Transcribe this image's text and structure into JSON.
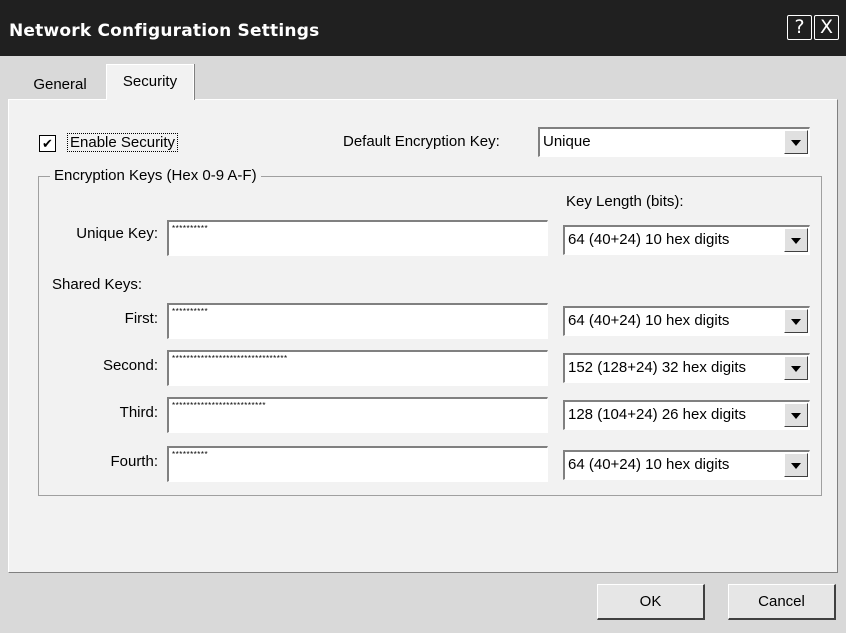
{
  "window": {
    "title": "Network Configuration Settings",
    "help_glyph": "?",
    "close_glyph": "X"
  },
  "tabs": [
    {
      "label": "General",
      "selected": false
    },
    {
      "label": "Security",
      "selected": true
    }
  ],
  "security": {
    "enable_label": "Enable Security",
    "enable_checked": true,
    "check_glyph": "✔",
    "default_key_label": "Default Encryption Key:",
    "default_key_value": "Unique"
  },
  "keys_group": {
    "legend": "Encryption Keys (Hex 0-9 A-F)",
    "key_length_label": "Key Length (bits):",
    "shared_keys_label": "Shared Keys:",
    "rows": [
      {
        "label": "Unique Key:",
        "value": "**********",
        "length": "64  (40+24)  10 hex digits"
      },
      {
        "label": "First:",
        "value": "**********",
        "length": "64  (40+24)  10 hex digits"
      },
      {
        "label": "Second:",
        "value": "********************************",
        "length": "152 (128+24) 32 hex digits"
      },
      {
        "label": "Third:",
        "value": "**************************",
        "length": "128 (104+24) 26 hex digits"
      },
      {
        "label": "Fourth:",
        "value": "**********",
        "length": "64  (40+24)  10 hex digits"
      }
    ]
  },
  "buttons": {
    "ok": "OK",
    "cancel": "Cancel"
  }
}
